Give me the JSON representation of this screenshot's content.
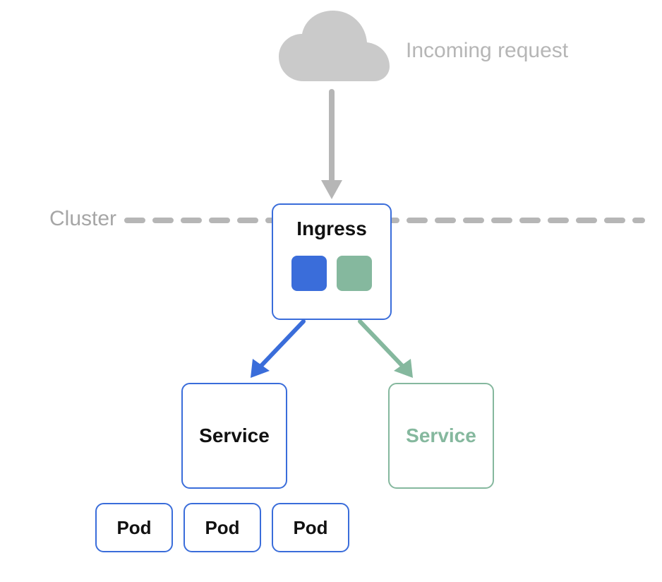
{
  "incoming_label": "Incoming request",
  "cluster_label": "Cluster",
  "ingress": {
    "label": "Ingress"
  },
  "service_blue": {
    "label": "Service"
  },
  "service_green": {
    "label": "Service"
  },
  "pods": [
    "Pod",
    "Pod",
    "Pod"
  ],
  "colors": {
    "blue": "#3A6DDA",
    "green": "#85B89E",
    "gray": "#B6B6B6",
    "cluster_text": "#A6A6A6"
  }
}
